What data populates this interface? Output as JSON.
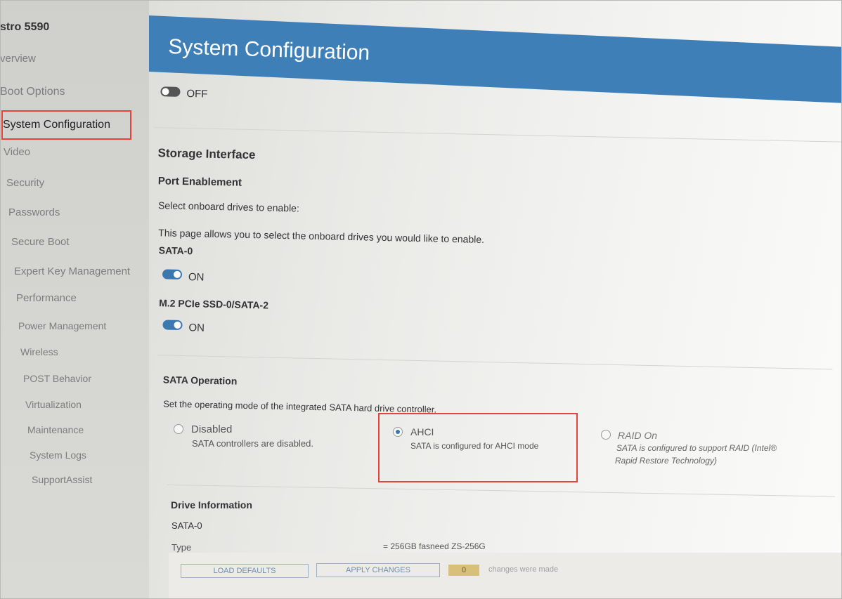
{
  "sidebar": {
    "title": "stro 5590",
    "items": [
      {
        "label": "verview"
      },
      {
        "label": "Boot Options"
      },
      {
        "label": "System Configuration"
      },
      {
        "label": "Video"
      },
      {
        "label": "Security"
      },
      {
        "label": "Passwords"
      },
      {
        "label": "Secure Boot"
      },
      {
        "label": "Expert Key Management"
      },
      {
        "label": "Performance"
      },
      {
        "label": "Power Management"
      },
      {
        "label": "Wireless"
      },
      {
        "label": "POST Behavior"
      },
      {
        "label": "Virtualization"
      },
      {
        "label": "Maintenance"
      },
      {
        "label": "System Logs"
      },
      {
        "label": "SupportAssist"
      }
    ],
    "active": "System Configuration"
  },
  "header": {
    "title": "System Configuration"
  },
  "top_toggle": {
    "state": "OFF"
  },
  "storage": {
    "title": "Storage Interface",
    "port_title": "Port Enablement",
    "port_prompt": "Select onboard drives to enable:",
    "port_desc": "This page allows you to select the onboard drives you would like to enable.",
    "drives": [
      {
        "name": "SATA-0",
        "state": "ON"
      },
      {
        "name": "M.2 PCIe SSD-0/SATA-2",
        "state": "ON"
      }
    ]
  },
  "sata_operation": {
    "title": "SATA Operation",
    "desc": "Set the operating mode of the integrated SATA hard drive controller.",
    "options": [
      {
        "label": "Disabled",
        "desc": "SATA controllers are disabled.",
        "selected": false
      },
      {
        "label": "AHCI",
        "desc": "SATA is configured for AHCI mode",
        "selected": true
      },
      {
        "label": "RAID On",
        "desc": "SATA is configured to support RAID (Intel®",
        "desc2": "Rapid Restore Technology)",
        "selected": false
      }
    ]
  },
  "drive_info": {
    "title": "Drive Information",
    "drive": "SATA-0",
    "row_label": "Type",
    "row_value": "= 256GB fasneed ZS-256G"
  },
  "bottom": {
    "load_defaults": "LOAD DEFAULTS",
    "apply_changes": "APPLY CHANGES",
    "changes_count": "0",
    "changes_text": "changes were made"
  },
  "colors": {
    "header_blue": "#3e7fb8",
    "toggle_on": "#3b78b0",
    "highlight_red": "#e8413e"
  }
}
